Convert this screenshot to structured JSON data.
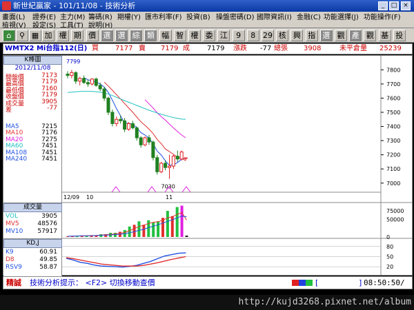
{
  "window": {
    "title": "新世紀贏家 - 101/11/08 - 技術分析"
  },
  "menus": [
    "畫面(L)",
    "證券(E)",
    "主力(M)",
    "籌碼(R)",
    "期權(Y)",
    "匯市利率(F)",
    "投資(B)",
    "操盤密碼(D)",
    "國際資訊(I)",
    "金融(C)",
    "功能選擇(J)",
    "功能操作(F)",
    "檢視(V)",
    "設定(S)",
    "工具(T)",
    "說明(H)"
  ],
  "toolbar": [
    "加",
    "權",
    "期",
    "價",
    "選",
    "選",
    "綜",
    "類",
    "幅",
    "智",
    "權",
    "委",
    "江",
    "9",
    "8",
    "29",
    "核",
    "興",
    "指",
    "選",
    "觀",
    "產",
    "觀",
    "基",
    "投"
  ],
  "quote": {
    "symbol": "WMTX2 Mi台指112(日)",
    "buy_label": "買",
    "buy": "7177",
    "sell_label": "賣",
    "sell": "7179",
    "deal_label": "成",
    "deal": "7179",
    "change_label": "漲跌",
    "change": "-77",
    "volume_label": "總張",
    "volume": "3908",
    "oi_label": "未平倉量",
    "oi": "25239"
  },
  "kline": {
    "header": "K棒圖",
    "date": "2012/11/08",
    "stats": [
      {
        "label": "開盤價",
        "value": "7173"
      },
      {
        "label": "最高價",
        "value": "7179"
      },
      {
        "label": "最低價",
        "value": "7160"
      },
      {
        "label": "收盤價",
        "value": "7179"
      },
      {
        "label": "成交量",
        "value": "3905"
      },
      {
        "label": "差",
        "value": "-77"
      }
    ],
    "ma": [
      {
        "label": "MA5",
        "value": "7215",
        "color": "#2050e0"
      },
      {
        "label": "MA10",
        "value": "7176",
        "color": "#e03030"
      },
      {
        "label": "MA20",
        "value": "7275",
        "color": "#e020e0"
      },
      {
        "label": "MA60",
        "value": "7451",
        "color": "#20c0c0"
      },
      {
        "label": "MA108",
        "value": "7451",
        "color": "#2050e0"
      },
      {
        "label": "MA240",
        "value": "7451",
        "color": "#2050e0"
      }
    ],
    "high_mark": "7799",
    "low_mark": "7030",
    "y_ticks": [
      "7800",
      "7700",
      "7600",
      "7500",
      "7400",
      "7300",
      "7200",
      "7100",
      "7000"
    ],
    "x_ticks": [
      "12/09",
      "10",
      "11"
    ]
  },
  "volume": {
    "header": "成交量",
    "rows": [
      {
        "label": "VOL",
        "value": "3905",
        "color": "#20c0c0"
      },
      {
        "label": "MV5",
        "value": "48576",
        "color": "#e03030"
      },
      {
        "label": "MV10",
        "value": "57917",
        "color": "#2050e0"
      }
    ],
    "y_ticks": [
      "75000",
      "50000",
      "0"
    ]
  },
  "kd": {
    "header": "KD,J",
    "rows": [
      {
        "label": "K9",
        "value": "60.91",
        "color": "#2050e0"
      },
      {
        "label": "D8",
        "value": "49.85",
        "color": "#e03030"
      },
      {
        "label": "RSV9",
        "value": "58.87",
        "color": "#2050e0"
      }
    ],
    "y_ticks": [
      "80",
      "50",
      "20"
    ]
  },
  "status": {
    "tag": "精誠",
    "hint": "技術分析提示： <F2> 切換移動查價",
    "time": "08:50:50/"
  },
  "watermark": {
    "url": "http://kujd3268.pixnet.net/album"
  },
  "chart_data": [
    {
      "type": "candlestick",
      "title": "K棒圖",
      "ylim": [
        6960,
        7860
      ],
      "x": [
        "12/09",
        "10",
        "11"
      ],
      "ohlc": [
        [
          7770,
          7790,
          7740,
          7760
        ],
        [
          7760,
          7799,
          7740,
          7780
        ],
        [
          7780,
          7790,
          7700,
          7720
        ],
        [
          7720,
          7750,
          7690,
          7740
        ],
        [
          7740,
          7760,
          7700,
          7710
        ],
        [
          7710,
          7730,
          7680,
          7700
        ],
        [
          7700,
          7740,
          7690,
          7735
        ],
        [
          7735,
          7745,
          7680,
          7690
        ],
        [
          7690,
          7710,
          7650,
          7665
        ],
        [
          7665,
          7680,
          7580,
          7600
        ],
        [
          7600,
          7610,
          7480,
          7500
        ],
        [
          7500,
          7520,
          7400,
          7420
        ],
        [
          7420,
          7470,
          7400,
          7450
        ],
        [
          7450,
          7480,
          7420,
          7440
        ],
        [
          7440,
          7460,
          7360,
          7380
        ],
        [
          7380,
          7430,
          7370,
          7420
        ],
        [
          7420,
          7440,
          7380,
          7390
        ],
        [
          7390,
          7400,
          7300,
          7320
        ],
        [
          7320,
          7330,
          7250,
          7270
        ],
        [
          7270,
          7330,
          7260,
          7320
        ],
        [
          7320,
          7340,
          7270,
          7290
        ],
        [
          7290,
          7300,
          7160,
          7180
        ],
        [
          7180,
          7200,
          7060,
          7080
        ],
        [
          7080,
          7150,
          7070,
          7140
        ],
        [
          7140,
          7160,
          7090,
          7110
        ],
        [
          7110,
          7200,
          7030,
          7120
        ],
        [
          7120,
          7200,
          7100,
          7190
        ],
        [
          7190,
          7230,
          7150,
          7170
        ],
        [
          7170,
          7230,
          7160,
          7220
        ],
        [
          7173,
          7179,
          7160,
          7179
        ]
      ],
      "series": [
        {
          "name": "MA5",
          "color": "#2050e0",
          "values": [
            null,
            null,
            null,
            null,
            7744,
            7730,
            7721,
            7713,
            7700,
            7678,
            7640,
            7585,
            7527,
            7475,
            7424,
            7422,
            7416,
            7392,
            7356,
            7340,
            7318,
            7278,
            7226,
            7198,
            7158,
            7126,
            7128,
            7146,
            7168,
            7178
          ]
        },
        {
          "name": "MA10",
          "color": "#e03030",
          "values": [
            null,
            null,
            null,
            null,
            null,
            null,
            null,
            null,
            null,
            7712,
            7686,
            7655,
            7624,
            7594,
            7562,
            7531,
            7500,
            7466,
            7433,
            7408,
            7381,
            7350,
            7309,
            7278,
            7241,
            7222,
            7203,
            7183,
            7172,
            7160
          ]
        },
        {
          "name": "MA20",
          "color": "#e020e0",
          "values": [
            null,
            null,
            null,
            null,
            null,
            null,
            null,
            null,
            null,
            null,
            null,
            null,
            null,
            null,
            null,
            null,
            null,
            null,
            null,
            7589,
            7560,
            7530,
            7497,
            7469,
            7445,
            7417,
            7390,
            7364,
            7340,
            7320
          ]
        },
        {
          "name": "MA60",
          "color": "#20c0c0",
          "values": [
            7640,
            7642,
            7645,
            7647,
            7648,
            7648,
            7648,
            7645,
            7642,
            7637,
            7628,
            7618,
            7606,
            7594,
            7582,
            7571,
            7560,
            7548,
            7537,
            7526,
            7514,
            7505,
            7495,
            7486,
            7478,
            7470,
            7463,
            7457,
            7452,
            7451
          ]
        }
      ]
    },
    {
      "type": "bar",
      "title": "成交量",
      "ylim": [
        0,
        95000
      ],
      "values": [
        2000,
        3000,
        3000,
        4000,
        3000,
        5000,
        4000,
        8000,
        8000,
        12000,
        12000,
        15000,
        20000,
        30000,
        35000,
        45000,
        35000,
        48000,
        42000,
        45000,
        55000,
        75000,
        60000,
        86000,
        90000,
        4000
      ],
      "colors": [
        "#e03030",
        "#e03030",
        "#20c040",
        "#e03030",
        "#20c040",
        "#e03030",
        "#e03030",
        "#20c040",
        "#e03030",
        "#20c040",
        "#20c040",
        "#e03030",
        "#20c040",
        "#20c040",
        "#e03030",
        "#20c040",
        "#e03030",
        "#20c040",
        "#20c040",
        "#20c040",
        "#e03030",
        "#20c040",
        "#e03030",
        "#20c040",
        "#e020e0",
        "#202020"
      ],
      "series": [
        {
          "name": "MV5",
          "color": "#e03030",
          "values": [
            2000,
            2600,
            3000,
            3500,
            3600,
            4200,
            4500,
            5500,
            6200,
            7600,
            9000,
            10500,
            13000,
            18000,
            24000,
            30000,
            34000,
            39000,
            42000,
            44000,
            48000,
            55000,
            58000,
            65000,
            70000,
            48576
          ]
        },
        {
          "name": "MV10",
          "color": "#2050e0",
          "values": [
            2000,
            2300,
            2700,
            3100,
            3400,
            3800,
            4200,
            4800,
            5400,
            6000,
            7000,
            8000,
            9500,
            12000,
            15000,
            19000,
            22000,
            27000,
            31000,
            35000,
            40000,
            45000,
            49000,
            55000,
            60000,
            57917
          ]
        }
      ]
    },
    {
      "type": "line",
      "title": "KD,J",
      "ylim": [
        0,
        100
      ],
      "series": [
        {
          "name": "K9",
          "color": "#2050e0",
          "values": [
            45,
            40,
            33,
            30,
            25,
            22,
            21,
            20,
            19,
            21,
            24,
            30,
            36,
            44,
            52,
            56,
            60,
            61
          ]
        },
        {
          "name": "D8",
          "color": "#e03030",
          "values": [
            47,
            44,
            40,
            36,
            32,
            28,
            26,
            24,
            22,
            22,
            22,
            24,
            28,
            32,
            37,
            42,
            46,
            50
          ]
        }
      ]
    }
  ]
}
